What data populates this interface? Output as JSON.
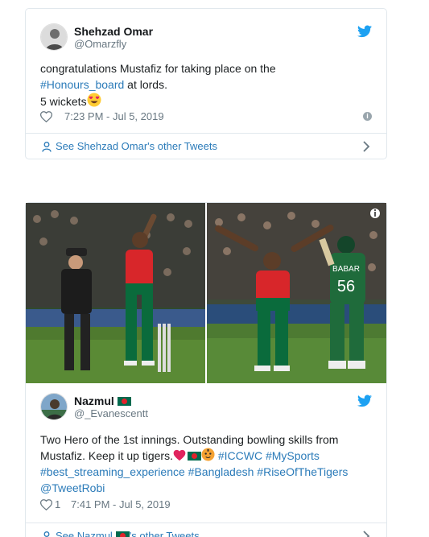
{
  "tweet1": {
    "name": "Shehzad Omar",
    "handle": "@Omarzfly",
    "text_line1": "congratulations Mustafiz for taking place on the",
    "hashtag": "#Honours_board",
    "text_line2_rest": " at lords.",
    "text_line3": "5 wickets",
    "time": "7:23 PM - Jul 5, 2019",
    "other_tweets": "See Shehzad Omar's other Tweets"
  },
  "tweet2": {
    "name": "Nazmul",
    "handle": "@_Evanescentt",
    "line1": "Two Hero of the 1st innings. Outstanding bowling skills from",
    "line2_text": "Mustafiz. Keep it up tigers.",
    "line2_tags": " #ICCWC #MySports",
    "line3": "#best_streaming_experience #Bangladesh #RiseOfTheTigers",
    "line4": "@TweetRobi",
    "likes": "1",
    "time": "7:41 PM - Jul 5, 2019",
    "other_tweets_pre": "See Nazmul",
    "other_tweets_post": "'s other Tweets"
  },
  "photo": {
    "right_jersey_name": "BABAR",
    "right_jersey_number": "56"
  },
  "colors": {
    "link": "#2b7bb9",
    "twitter_blue": "#1da1f2",
    "border": "#e1e8ed",
    "muted": "#697882"
  }
}
